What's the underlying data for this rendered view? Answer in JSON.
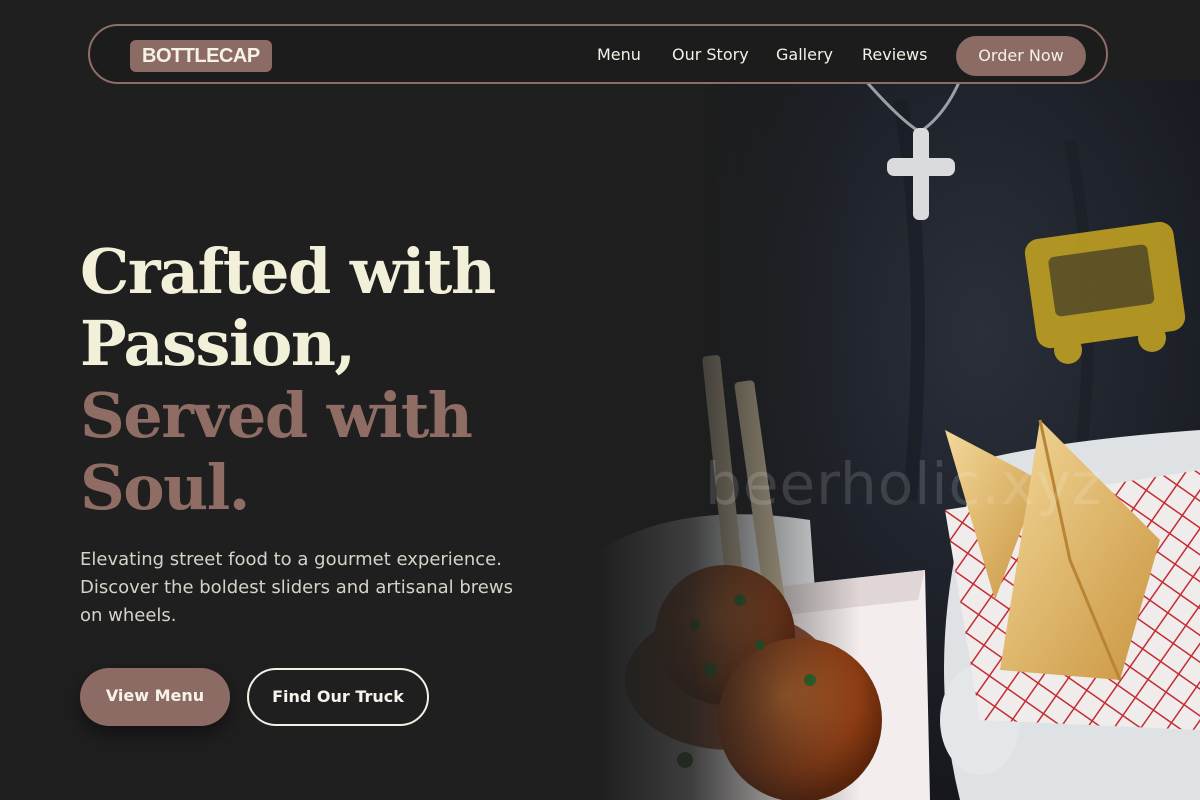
{
  "brand": {
    "name": "BOTTLECAP"
  },
  "nav": {
    "items": [
      {
        "label": "Menu"
      },
      {
        "label": "Our Story"
      },
      {
        "label": "Gallery"
      },
      {
        "label": "Reviews"
      }
    ],
    "cta_label": "Order Now"
  },
  "hero": {
    "headline_line1": "Crafted with",
    "headline_line2": "Passion,",
    "headline_line3": "Served with",
    "headline_line4": "Soul.",
    "lead": "Elevating street food to a gourmet experience. Discover the boldest sliders and artisanal brews on wheels.",
    "primary_button": "View Menu",
    "secondary_button": "Find Our Truck",
    "watermark": "beerholic.xyz"
  },
  "colors": {
    "background": "#1f1f1f",
    "accent": "#8b6b63",
    "headline_light": "#f3f0da",
    "headline_accent": "#8f6d65"
  },
  "icons": {
    "hero_image": "food-truck-chef-holding-meatballs-and-samosas-photo"
  }
}
